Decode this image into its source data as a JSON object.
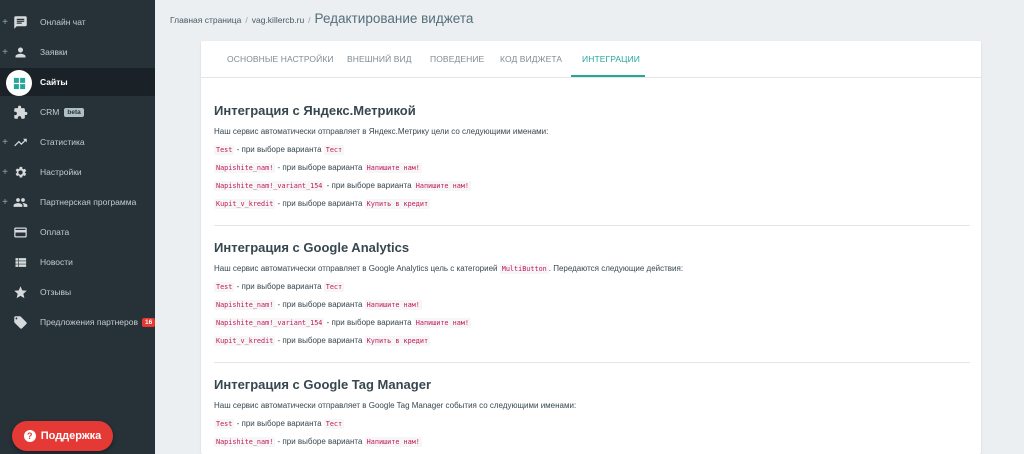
{
  "sidebar": {
    "items": [
      {
        "label": "Онлайн чат",
        "icon": "chat-icon"
      },
      {
        "label": "Заявки",
        "icon": "user-icon"
      },
      {
        "label": "Сайты",
        "icon": "sites-icon"
      },
      {
        "label": "CRM",
        "icon": "puzzle-icon",
        "badge": "beta"
      },
      {
        "label": "Статистика",
        "icon": "trending-icon"
      },
      {
        "label": "Настройки",
        "icon": "gear-icon"
      },
      {
        "label": "Партнерская программа",
        "icon": "people-icon"
      },
      {
        "label": "Оплата",
        "icon": "card-icon"
      },
      {
        "label": "Новости",
        "icon": "news-icon"
      },
      {
        "label": "Отзывы",
        "icon": "star-icon"
      },
      {
        "label": "Предложения партнеров",
        "icon": "tag-icon",
        "badge": "16"
      }
    ],
    "support_label": "Поддержка"
  },
  "breadcrumb": {
    "home": "Главная страница",
    "site": "vag.killercb.ru",
    "sep": "/",
    "title": "Редактирование виджета"
  },
  "tabs": [
    "ОСНОВНЫЕ НАСТРОЙКИ",
    "ВНЕШНИЙ ВИД",
    "ПОВЕДЕНИЕ",
    "КОД ВИДЖЕТА",
    "ИНТЕГРАЦИИ"
  ],
  "sections": {
    "yandex": {
      "title": "Интеграция с Яндекс.Метрикой",
      "desc": "Наш сервис автоматически отправляет в Яндекс.Метрику цели со следующими именами:",
      "lines": [
        {
          "code": "Test",
          "text": " - при выборе варианта ",
          "variant": "Тест"
        },
        {
          "code": "Napishite_nam!",
          "text": " - при выборе варианта ",
          "variant": "Напишите нам!"
        },
        {
          "code": "Napishite_nam!_variant_154",
          "text": " - при выборе варианта ",
          "variant": "Напишите нам!"
        },
        {
          "code": "Kupit_v_kredit",
          "text": " - при выборе варианта ",
          "variant": "Купить в кредит"
        }
      ]
    },
    "google_analytics": {
      "title": "Интеграция с Google Analytics",
      "desc_before": "Наш сервис автоматически отправляет в Google Analytics цель с категорией ",
      "desc_code": "MultiButton",
      "desc_after": ". Передаются следующие действия:",
      "lines": [
        {
          "code": "Test",
          "text": " - при выборе варианта ",
          "variant": "Тест"
        },
        {
          "code": "Napishite_nam!",
          "text": " - при выборе варианта ",
          "variant": "Напишите нам!"
        },
        {
          "code": "Napishite_nam!_variant_154",
          "text": " - при выборе варианта ",
          "variant": "Напишите нам!"
        },
        {
          "code": "Kupit_v_kredit",
          "text": " - при выборе варианта ",
          "variant": "Купить в кредит"
        }
      ]
    },
    "gtm": {
      "title": "Интеграция с Google Tag Manager",
      "desc": "Наш сервис автоматически отправляет в Google Tag Manager события со следующими именами:",
      "lines": [
        {
          "code": "Test",
          "text": " - при выборе варианта ",
          "variant": "Тест"
        },
        {
          "code": "Napishite_nam!",
          "text": " - при выборе варианта ",
          "variant": "Напишите нам!"
        }
      ]
    }
  },
  "colors": {
    "sidebar_bg": "#263238",
    "accent": "#26a69a",
    "danger": "#e53935",
    "code": "#c2185b"
  }
}
